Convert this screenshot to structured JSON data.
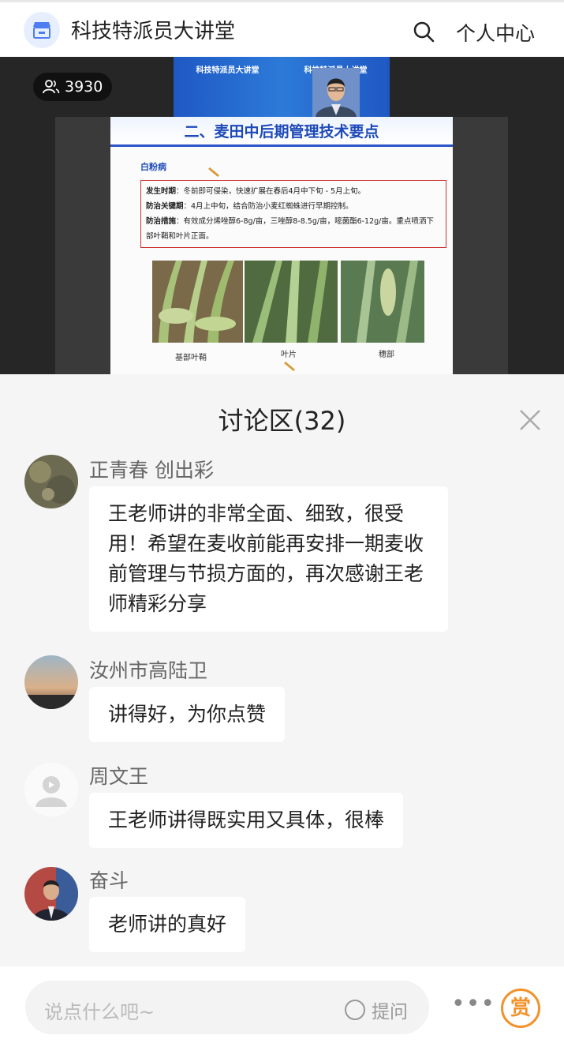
{
  "header": {
    "title": "科技特派员大讲堂",
    "personal_center": "个人中心",
    "logo_icon": "store-icon",
    "search_icon": "search-icon"
  },
  "video": {
    "viewer_count": "3930",
    "banner_left": "科技特派员大讲堂",
    "banner_right": "科技特派员大讲堂",
    "slide": {
      "title": "二、麦田中后期管理技术要点",
      "topic": "白粉病",
      "lines": [
        {
          "label": "发生时期",
          "text": "：冬前即可侵染，快速扩展在春后4月中下旬 - 5月上旬。"
        },
        {
          "label": "防治关键期",
          "text": "：4月上中旬，结合防治小麦红蜘蛛进行早期控制。"
        },
        {
          "label": "防治措施",
          "text": "：有效成分烯唑醇6-8g/亩，三唑醇8-8.5g/亩，嘧菌酯6-12g/亩。重点喷洒下部叶鞘和叶片正面。"
        }
      ],
      "photo_labels": [
        "基部叶鞘",
        "叶片",
        "穗部"
      ]
    }
  },
  "discussion": {
    "title": "讨论区(32)",
    "messages": [
      {
        "name": "正青春 创出彩",
        "text": "王老师讲的非常全面、细致，很受用！希望在麦收前能再安排一期麦收前管理与节损方面的，再次感谢王老师精彩分享"
      },
      {
        "name": "汝州市高陆卫",
        "text": "讲得好，为你点赞"
      },
      {
        "name": "周文王",
        "text": "王老师讲得既实用又具体，很棒"
      },
      {
        "name": "奋斗",
        "text": "老师讲的真好"
      }
    ]
  },
  "input_bar": {
    "placeholder": "说点什么吧~",
    "ask_label": "提问",
    "more_label": "•••",
    "reward_label": "赏"
  },
  "colors": {
    "accent_orange": "#f2922a",
    "slide_blue": "#1e4ab8"
  }
}
